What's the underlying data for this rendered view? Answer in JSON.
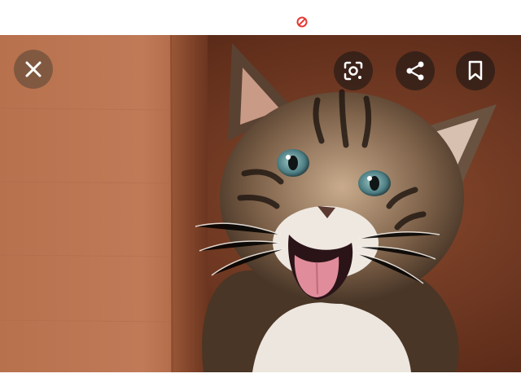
{
  "viewer": {
    "accent_color": "#e53935",
    "status_icon": "blocked-circle-icon"
  },
  "image": {
    "subject": "kitten photo",
    "background_color": "#7a3f26"
  },
  "controls": {
    "close_icon": "close-icon",
    "lens_icon": "lens-search-icon",
    "share_icon": "share-icon",
    "save_icon": "bookmark-icon"
  }
}
